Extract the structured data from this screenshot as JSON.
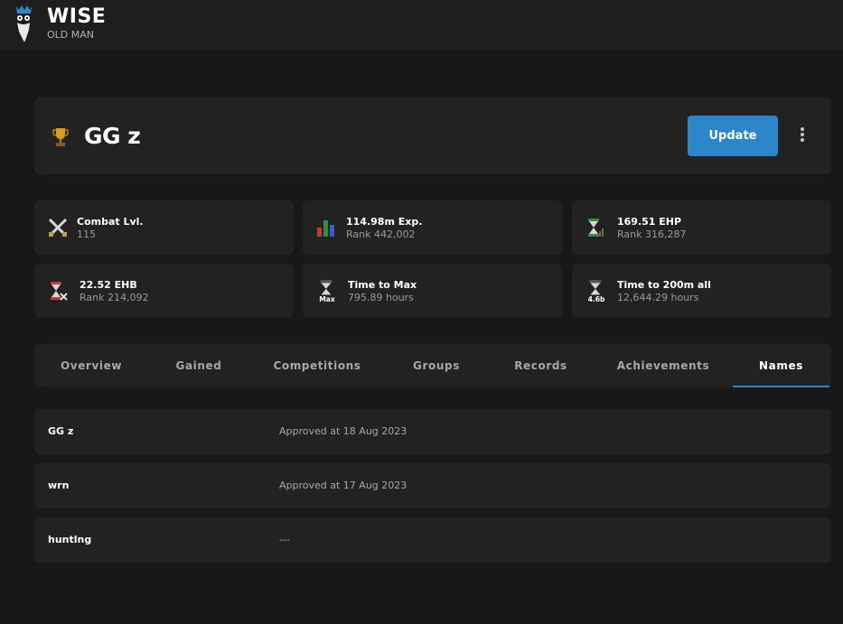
{
  "brand": {
    "title": "WISE",
    "subtitle": "OLD MAN"
  },
  "player": {
    "name": "GG z",
    "update_label": "Update"
  },
  "stats": [
    {
      "icon": "combat-icon",
      "value": "Combat Lvl.",
      "sub": "115"
    },
    {
      "icon": "overall-exp-icon",
      "value": "114.98m Exp.",
      "sub": "Rank 442,002"
    },
    {
      "icon": "ehp-icon",
      "value": "169.51 EHP",
      "sub": "Rank 316,287"
    },
    {
      "icon": "ehb-icon",
      "value": "22.52 EHB",
      "sub": "Rank 214,092"
    },
    {
      "icon": "max-hourglass-icon",
      "value": "Time to Max",
      "sub": "795.89 hours",
      "badge": "Max"
    },
    {
      "icon": "200m-hourglass-icon",
      "value": "Time to 200m all",
      "sub": "12,644.29 hours",
      "badge": "4.6b"
    }
  ],
  "tabs": [
    {
      "label": "Overview"
    },
    {
      "label": "Gained"
    },
    {
      "label": "Competitions"
    },
    {
      "label": "Groups"
    },
    {
      "label": "Records"
    },
    {
      "label": "Achievements"
    },
    {
      "label": "Names",
      "active": true
    }
  ],
  "names": [
    {
      "name": "GG z",
      "status": "Approved at 18 Aug 2023"
    },
    {
      "name": "wrn",
      "status": "Approved at 17 Aug 2023"
    },
    {
      "name": "huntlng",
      "status": "---"
    }
  ],
  "colors": {
    "accent": "#2c86c9",
    "background": "#181818",
    "card": "#222222"
  }
}
